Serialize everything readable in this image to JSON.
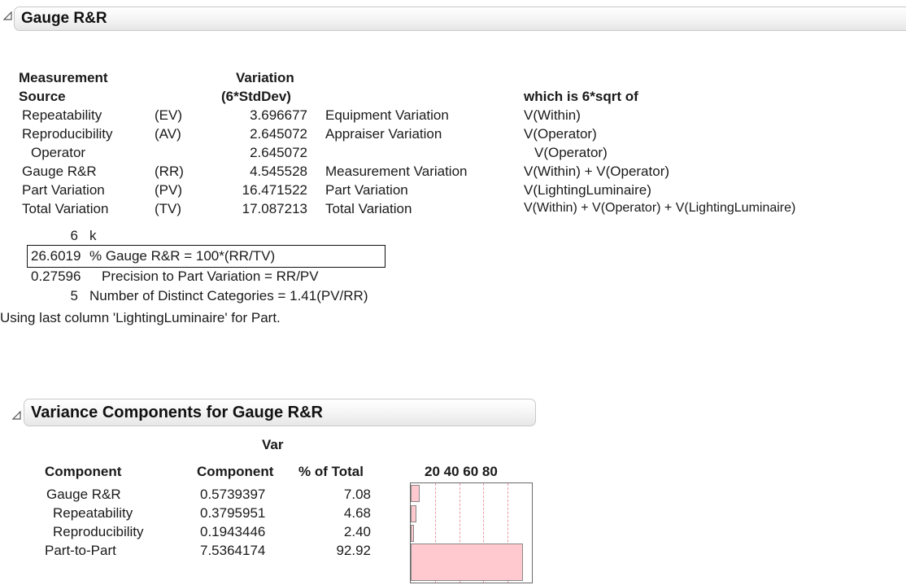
{
  "gauge_rr": {
    "title": "Gauge R&R",
    "headers": {
      "measurement": "Measurement",
      "source": "Source",
      "variation": "Variation",
      "stddev": "(6*StdDev)",
      "which": "which is 6*sqrt of"
    },
    "rows": [
      {
        "source": "Repeatability",
        "abbr": "(EV)",
        "value": "3.696677",
        "description": "Equipment Variation",
        "formula": "V(Within)"
      },
      {
        "source": "Reproducibility",
        "abbr": "(AV)",
        "value": "2.645072",
        "description": "Appraiser Variation",
        "formula": "V(Operator)"
      },
      {
        "source": "Operator",
        "abbr": "",
        "value": "2.645072",
        "description": "",
        "formula": "V(Operator)"
      },
      {
        "source": "Gauge R&R",
        "abbr": "(RR)",
        "value": "4.545528",
        "description": "Measurement Variation",
        "formula": "V(Within) + V(Operator)"
      },
      {
        "source": "Part Variation",
        "abbr": "(PV)",
        "value": "16.471522",
        "description": "Part Variation",
        "formula": "V(LightingLuminaire)"
      },
      {
        "source": "Total Variation",
        "abbr": "(TV)",
        "value": "17.087213",
        "description": "Total Variation",
        "formula": "V(Within) + V(Operator)  + V(LightingLuminaire)"
      }
    ],
    "stats": [
      {
        "value": "6",
        "label": "k"
      },
      {
        "value": "26.6019",
        "label": "% Gauge R&R = 100*(RR/TV)"
      },
      {
        "value": "0.27596",
        "label": "Precision to Part Variation = RR/PV"
      },
      {
        "value": "5",
        "label": "Number of Distinct Categories = 1.41(PV/RR)"
      }
    ],
    "note": "Using last column 'LightingLuminaire' for Part."
  },
  "variance_components": {
    "title": "Variance Components for Gauge R&R",
    "headers": {
      "component": "Component",
      "var": "Var",
      "var_component": "Component",
      "pct": "% of Total",
      "axis": "20 40 60 80"
    },
    "rows": [
      {
        "component": "Gauge R&R",
        "var_component": "0.5739397",
        "pct": "7.08"
      },
      {
        "component": "Repeatability",
        "var_component": "0.3795951",
        "pct": "4.68"
      },
      {
        "component": "Reproducibility",
        "var_component": "0.1943446",
        "pct": "2.40"
      },
      {
        "component": "Part-to-Part",
        "var_component": "7.5364174",
        "pct": "92.92"
      }
    ],
    "bar_percentages": [
      7.08,
      4.68,
      2.4,
      92.92
    ],
    "bar_fill_color": "#ffc9cf",
    "grid_color": "#e79aa6"
  }
}
